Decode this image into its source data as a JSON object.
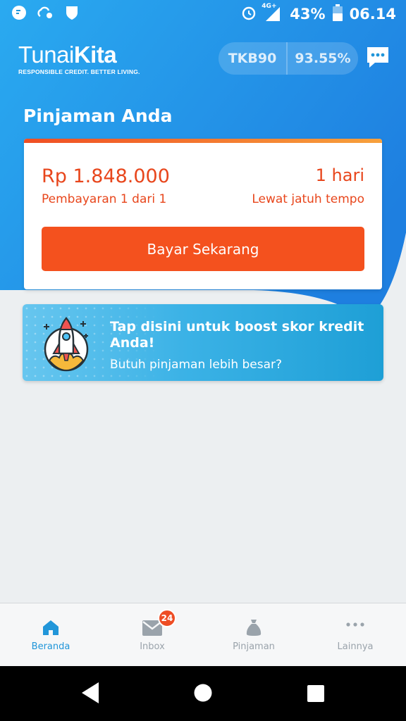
{
  "status_bar": {
    "network": "4G+",
    "battery": "43%",
    "time": "06.14",
    "icons": [
      "app-notification-icon",
      "weather-settings-icon",
      "shield-icon",
      "alarm-icon",
      "signal-icon",
      "battery-icon"
    ]
  },
  "header": {
    "logo_light": "Tunai",
    "logo_bold": "Kita",
    "logo_tagline": "RESPONSIBLE CREDIT. BETTER LIVING.",
    "score_label": "TKB90",
    "score_value": "93.55%",
    "chat_icon": "chat-bubble-icon"
  },
  "loan": {
    "section_title": "Pinjaman Anda",
    "amount": "Rp 1.848.000",
    "days": "1 hari",
    "payment_info": "Pembayaran 1 dari 1",
    "status": "Lewat jatuh tempo",
    "pay_button": "Bayar Sekarang"
  },
  "boost": {
    "title": "Tap disini untuk boost skor kredit Anda!",
    "subtitle": "Butuh pinjaman lebih besar?",
    "icon": "rocket-icon"
  },
  "bottom_nav": {
    "items": [
      {
        "label": "Beranda",
        "icon": "home-icon",
        "active": true
      },
      {
        "label": "Inbox",
        "icon": "mail-icon",
        "badge": "24"
      },
      {
        "label": "Pinjaman",
        "icon": "money-bag-icon"
      },
      {
        "label": "Lainnya",
        "icon": "more-icon"
      }
    ]
  },
  "colors": {
    "primary_blue": "#2196d9",
    "accent_orange": "#f4511e",
    "background": "#eceff1"
  }
}
